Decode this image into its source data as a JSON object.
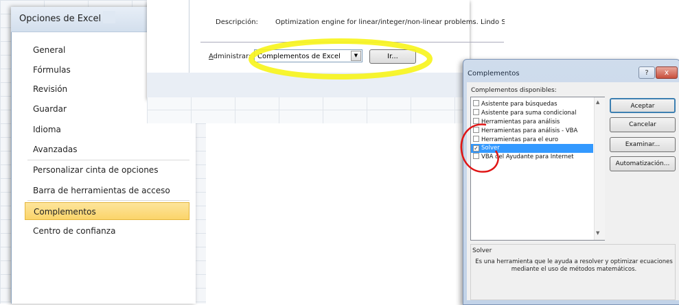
{
  "excel_options": {
    "title": "Opciones de Excel",
    "nav": [
      {
        "label": "General"
      },
      {
        "label": "Fórmulas"
      },
      {
        "label": "Revisión"
      },
      {
        "label": "Guardar"
      },
      {
        "label": "Idioma"
      },
      {
        "label": "Avanzadas"
      },
      {
        "label": "Personalizar cinta de opciones"
      },
      {
        "label": "Barra de herramientas de acceso rápido"
      },
      {
        "label": "Complementos",
        "selected": true
      },
      {
        "label": "Centro de confianza"
      }
    ]
  },
  "addins_panel": {
    "description_label": "Descripción:",
    "description_text": "Optimization engine for linear/integer/non-linear problems.  Lindo Sy",
    "manage_label": "Administrar:",
    "manage_value": "Complementos de Excel",
    "go_button": "Ir...",
    "highlight_color": "#f7f41a"
  },
  "complementos_dialog": {
    "title": "Complementos",
    "help_icon": "?",
    "close_icon": "x",
    "available_label": "Complementos disponibles:",
    "items": [
      {
        "label": "Asistente para búsquedas",
        "checked": false
      },
      {
        "label": "Asistente para suma condicional",
        "checked": false
      },
      {
        "label": "Herramientas para análisis",
        "checked": false
      },
      {
        "label": "Herramientas para análisis - VBA",
        "checked": false
      },
      {
        "label": "Herramientas para el euro",
        "checked": false
      },
      {
        "label": "Solver",
        "checked": true
      },
      {
        "label": "VBA del Ayudante para Internet",
        "checked": false
      }
    ],
    "buttons": {
      "accept": "Aceptar",
      "cancel": "Cancelar",
      "browse": "Examinar...",
      "automation": "Automatización..."
    },
    "selected_name": "Solver",
    "selected_description": "Es una herramienta que le ayuda a resolver y optimizar ecuaciones mediante el uso de métodos matemáticos.",
    "selection_color": "#3399ff",
    "annotation_color": "#e01515"
  }
}
